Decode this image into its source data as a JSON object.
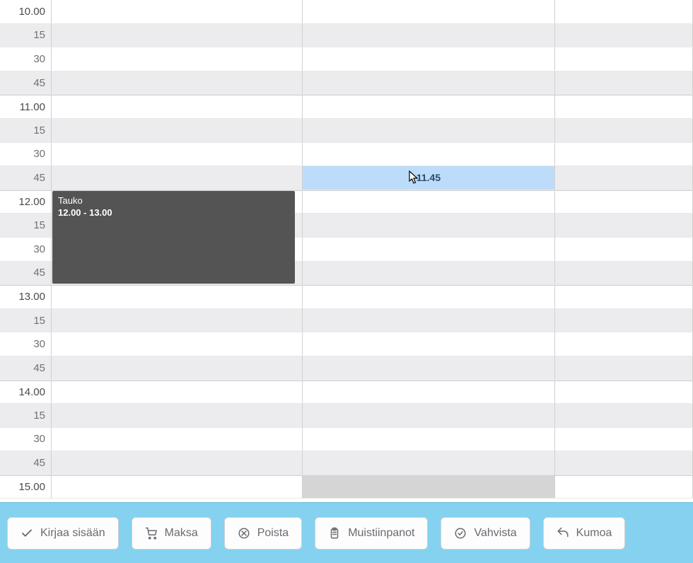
{
  "timeSlots": [
    {
      "label": "10.00",
      "type": "hour",
      "alt": false
    },
    {
      "label": "15",
      "type": "minor",
      "alt": true
    },
    {
      "label": "30",
      "type": "minor",
      "alt": false
    },
    {
      "label": "45",
      "type": "minor",
      "alt": true
    },
    {
      "label": "11.00",
      "type": "hour",
      "alt": false
    },
    {
      "label": "15",
      "type": "minor",
      "alt": true
    },
    {
      "label": "30",
      "type": "minor",
      "alt": false
    },
    {
      "label": "45",
      "type": "minor",
      "alt": true
    },
    {
      "label": "12.00",
      "type": "hour",
      "alt": false
    },
    {
      "label": "15",
      "type": "minor",
      "alt": true
    },
    {
      "label": "30",
      "type": "minor",
      "alt": false
    },
    {
      "label": "45",
      "type": "minor",
      "alt": true
    },
    {
      "label": "13.00",
      "type": "hour",
      "alt": false
    },
    {
      "label": "15",
      "type": "minor",
      "alt": true
    },
    {
      "label": "30",
      "type": "minor",
      "alt": false
    },
    {
      "label": "45",
      "type": "minor",
      "alt": true
    },
    {
      "label": "14.00",
      "type": "hour",
      "alt": false
    },
    {
      "label": "15",
      "type": "minor",
      "alt": true
    },
    {
      "label": "30",
      "type": "minor",
      "alt": false
    },
    {
      "label": "45",
      "type": "minor",
      "alt": true
    },
    {
      "label": "15.00",
      "type": "hour",
      "alt": false
    }
  ],
  "hoverSlot": {
    "rowIndex": 7,
    "colIndex": 1,
    "label": "11.45"
  },
  "disabledSlot": {
    "rowIndex": 20,
    "colIndex": 1
  },
  "event": {
    "title": "Tauko",
    "time": "12.00 - 13.00",
    "startRow": 8,
    "endRow": 12,
    "colIndex": 0
  },
  "toolbar": {
    "checkin": "Kirjaa sisään",
    "pay": "Maksa",
    "delete": "Poista",
    "notes": "Muistiinpanot",
    "confirm": "Vahvista",
    "undo": "Kumoa"
  }
}
